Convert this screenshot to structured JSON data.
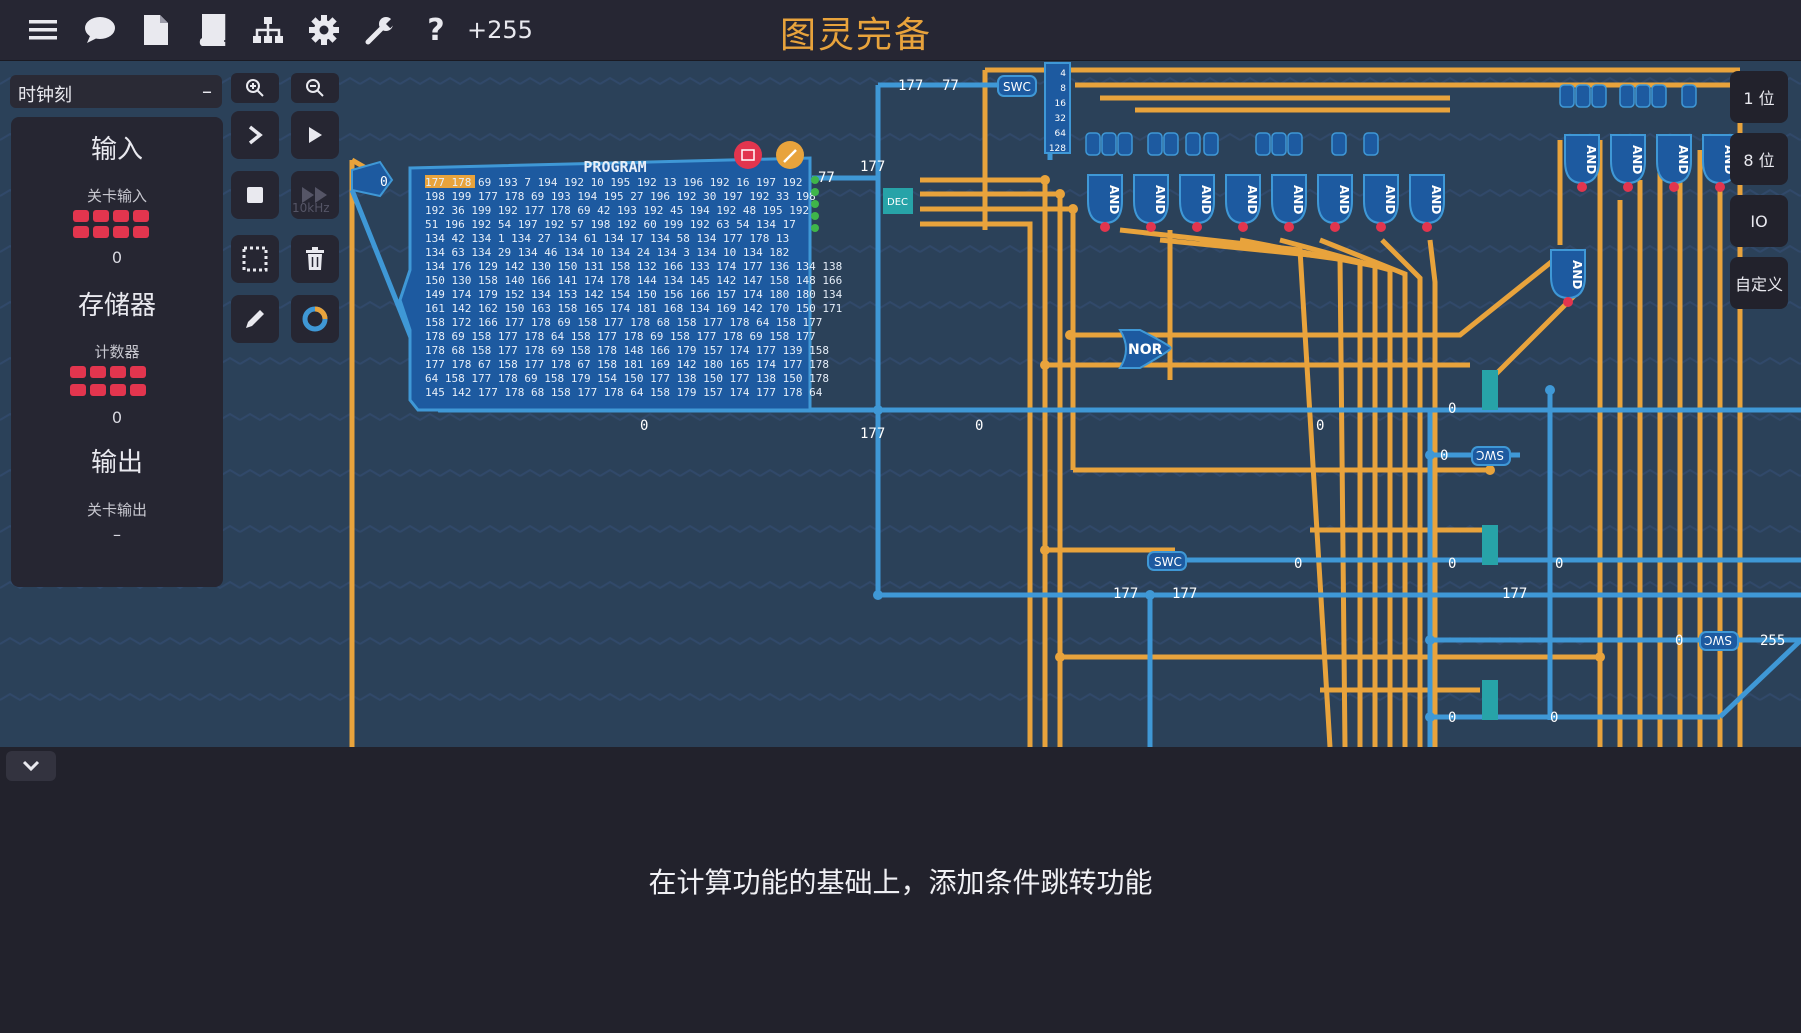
{
  "app": {
    "title": "图灵完备",
    "score": "+255"
  },
  "toolbar": {
    "icons": [
      "menu-icon",
      "chat-icon",
      "file-icon",
      "book-icon",
      "hierarchy-icon",
      "gear-icon",
      "wrench-icon",
      "help-icon"
    ]
  },
  "side": {
    "clock_label": "时钟刻",
    "clock_dash": "–",
    "input_title": "输入",
    "input_sub": "关卡输入",
    "input_value": "0",
    "memory_title": "存储器",
    "memory_sub": "计数器",
    "memory_value": "0",
    "output_title": "输出",
    "output_sub": "关卡输出",
    "output_value": "–"
  },
  "controls": {
    "speed": "10kHz"
  },
  "right_tabs": [
    "1 位",
    "8 位",
    "IO",
    "自定义"
  ],
  "board": {
    "program_title": "PROGRAM",
    "program_rows": [
      "177 178 69 193  7 194 192 10 195 192 13 196 192 16 197 192",
      "198 199 177 178 69 193 194 195 27 196 192 30 197 192 33 198",
      "192 36 199 192 177 178 69 42 193 192 45 194 192 48 195 192",
      " 51 196 192 54 197 192 57 198 192 60 199 192 63 54 134 17",
      "134 42 134  1 134 27 134 61 134 17 134 58 134 177 178 13",
      "134 63 134 29 134 46 134 10 134 24 134  3 134 10 134 182",
      "134 176 129 142 130 150 131 158 132 166 133 174 177 136 134 138",
      "150 130 158 140 166 141 174 178 144 134 145 142 147 158 148 166",
      "149 174 179 152 134 153 142 154 150 156 166 157 174 180 180 134",
      "161 142 162 150 163 158 165 174 181 168 134 169 142 170 150 171",
      "158 172 166 177 178 69 158 177 178 68 158 177 178 64 158 177",
      "178 69 158 177 178 64 158 177 178 69 158 177 178 69 158 177",
      "178 68 158 177 178 69 158 178 148 166 179 157 174 177 139 158",
      "177 178 67 158 177 178 67 158 181 169 142 180 165 174 177 178",
      " 64 158 177 178 69 158 179 154 150 177 138 150 177 138 150 178",
      "145 142 177 178 68 158 177 178 64 158 179 157 174 177 178 64"
    ],
    "labels": {
      "v177a": "177",
      "v77a": "77",
      "v77b": "77",
      "v177b": "177",
      "v177c": "177",
      "v0a": "0",
      "v0b": "0",
      "v0c": "0",
      "v0d": "0",
      "v177d": "177",
      "v177e": "177",
      "v177f": "177",
      "v255": "255",
      "swc1": "SWC",
      "swc2": "SWC",
      "swc3": "SWC",
      "dec": "DEC",
      "nor": "NOR",
      "and": "AND",
      "bits": [
        "4",
        "8",
        "16",
        "32",
        "64",
        "128"
      ]
    }
  },
  "description": "在计算功能的基础上，添加条件跳转功能"
}
